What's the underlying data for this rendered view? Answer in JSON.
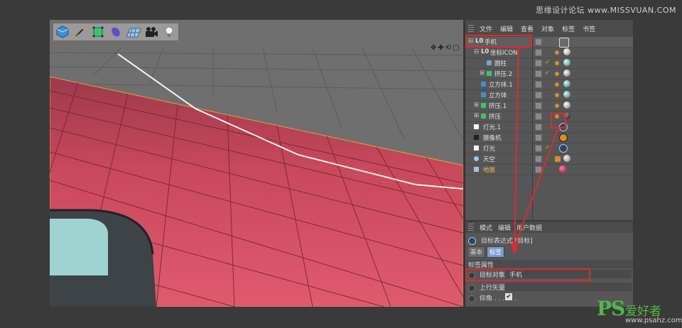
{
  "watermark": "思缘设计论坛 www.MISSVUAN.COM",
  "toolbar": {
    "icons": [
      "cube-icon",
      "pen-icon",
      "subdivide-icon",
      "deformer-icon",
      "floor-icon",
      "camera-icon",
      "light-icon"
    ]
  },
  "object_manager": {
    "menu": [
      "文件",
      "编辑",
      "查看",
      "对象",
      "标签",
      "书签"
    ],
    "objects": [
      {
        "label": "手机",
        "indent": 0,
        "icon": "null"
      },
      {
        "label": "坐标ICON",
        "indent": 1,
        "icon": "null"
      },
      {
        "label": "圆柱",
        "indent": 2,
        "icon": "cylinder"
      },
      {
        "label": "挤压.2",
        "indent": 2,
        "icon": "extrude"
      },
      {
        "label": "立方体.1",
        "indent": 2,
        "icon": "cube"
      },
      {
        "label": "立方体",
        "indent": 2,
        "icon": "cube"
      },
      {
        "label": "挤压.1",
        "indent": 1,
        "icon": "extrude"
      },
      {
        "label": "挤压",
        "indent": 1,
        "icon": "extrude"
      },
      {
        "label": "灯光.1",
        "indent": 0,
        "icon": "light"
      },
      {
        "label": "摄像机",
        "indent": 0,
        "icon": "camera"
      },
      {
        "label": "灯光",
        "indent": 0,
        "icon": "light"
      },
      {
        "label": "天空",
        "indent": 0,
        "icon": "sky"
      },
      {
        "label": "地面",
        "indent": 0,
        "icon": "floor"
      }
    ]
  },
  "attributes": {
    "menu": [
      "模式",
      "编辑",
      "用户数据"
    ],
    "title": "目标表达式 [目标]",
    "tabs": [
      "基本",
      "标签"
    ],
    "section": "标签属性",
    "fields": [
      {
        "label": "目标对象",
        "value": "手机"
      },
      {
        "label": "上行矢量 . .",
        "value": ""
      },
      {
        "label": "仰角 . . . . . .",
        "value": "✔"
      }
    ]
  },
  "brand": {
    "logo": "PS",
    "cn": "爱好者",
    "url": "www.psahz.com"
  },
  "colors": {
    "floor": "#d44d61",
    "accent_red": "#e12a2a"
  }
}
